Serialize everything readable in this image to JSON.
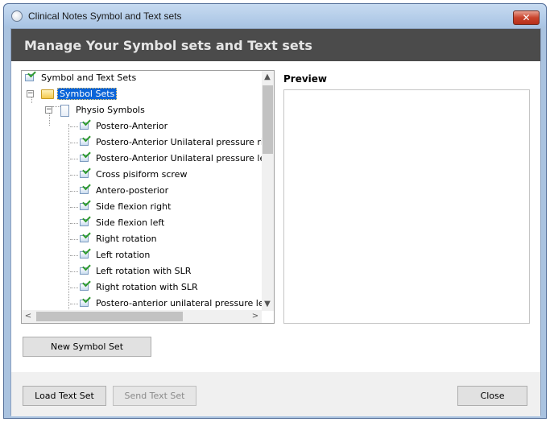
{
  "window": {
    "title": "Clinical Notes Symbol and Text sets",
    "close_glyph": "✕"
  },
  "header": {
    "title": "Manage Your Symbol sets and Text sets"
  },
  "tree": {
    "root": "Symbol and Text Sets",
    "folder": "Symbol Sets",
    "set": "Physio Symbols",
    "items": [
      "Postero-Anterior",
      "Postero-Anterior Unilateral pressure right",
      "Postero-Anterior Unilateral pressure left",
      "Cross pisiform screw",
      "Antero-posterior",
      "Side flexion right",
      "Side flexion left",
      "Right rotation",
      "Left rotation",
      "Left rotation with SLR",
      "Right rotation with SLR",
      "Postero-anterior unilateral pressure left or"
    ],
    "expander_minus": "−",
    "scroll_up": "▲",
    "scroll_down": "▼",
    "scroll_left": "<",
    "scroll_right": ">"
  },
  "preview": {
    "label": "Preview"
  },
  "buttons": {
    "new_symbol_set": "New Symbol Set",
    "load_text_set": "Load Text Set",
    "send_text_set": "Send Text Set",
    "close": "Close"
  },
  "icons": {
    "tree_item": "check-leaf-icon",
    "folder": "folder-icon",
    "document": "document-icon",
    "app": "app-icon"
  }
}
